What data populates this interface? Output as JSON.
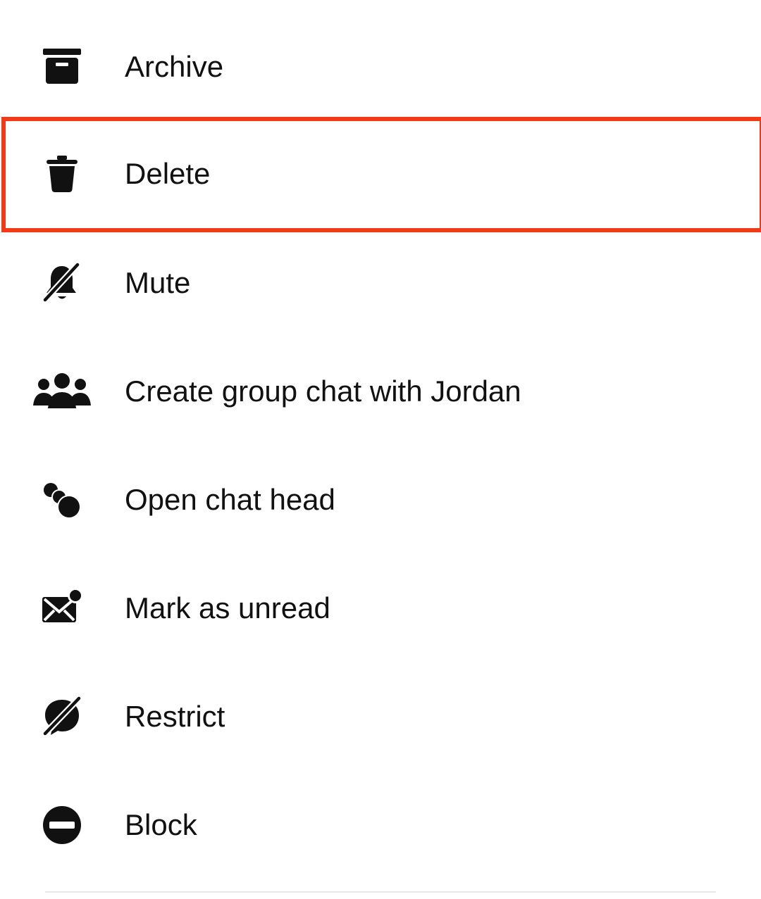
{
  "menu": {
    "items": [
      {
        "id": "archive",
        "label": "Archive",
        "icon": "archive-icon"
      },
      {
        "id": "delete",
        "label": "Delete",
        "icon": "trash-icon",
        "highlighted": true
      },
      {
        "id": "mute",
        "label": "Mute",
        "icon": "bell-off-icon"
      },
      {
        "id": "create-group",
        "label": "Create group chat with Jordan",
        "icon": "group-icon"
      },
      {
        "id": "open-chat-head",
        "label": "Open chat head",
        "icon": "chat-heads-icon"
      },
      {
        "id": "mark-unread",
        "label": "Mark as unread",
        "icon": "envelope-dot-icon"
      },
      {
        "id": "restrict",
        "label": "Restrict",
        "icon": "chat-bubble-slash-icon"
      },
      {
        "id": "block",
        "label": "Block",
        "icon": "minus-circle-icon"
      }
    ]
  },
  "colors": {
    "highlight": "#f23a16",
    "text": "#111111",
    "background": "#ffffff"
  }
}
